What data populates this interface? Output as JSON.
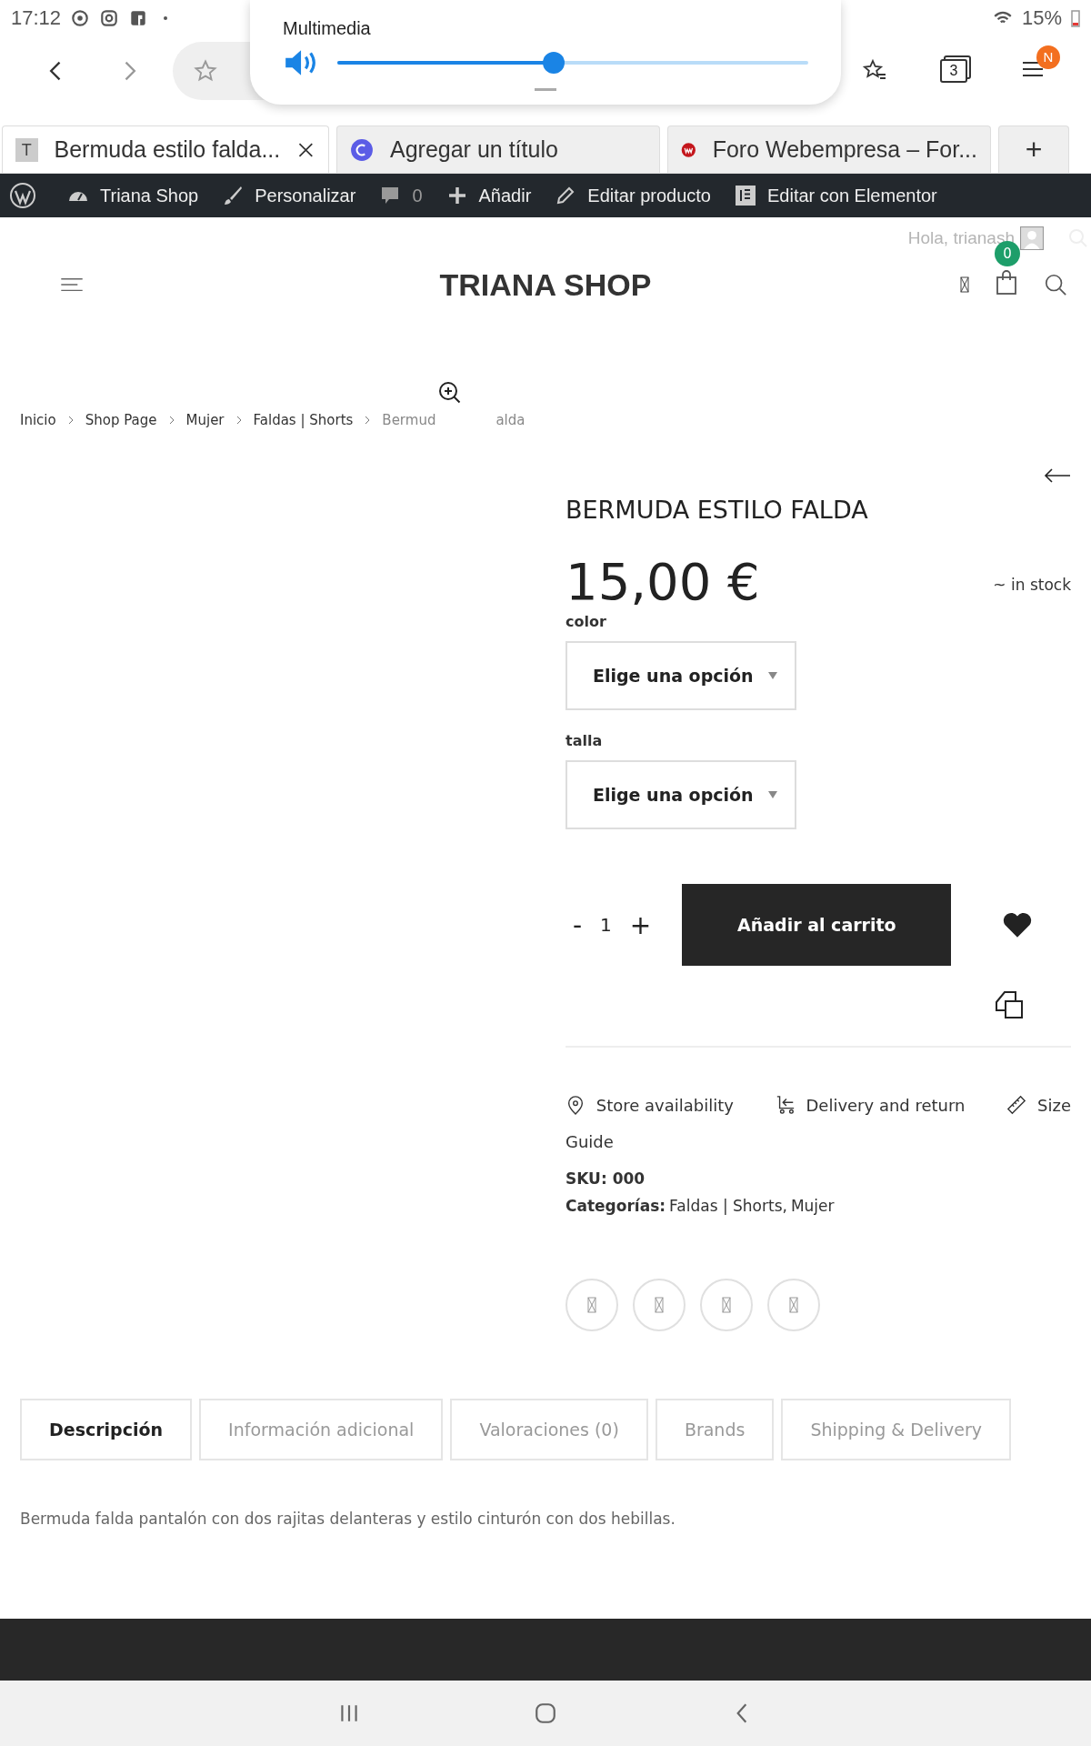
{
  "status_bar": {
    "time": "17:12",
    "battery": "15%"
  },
  "volume_popup": {
    "title": "Multimedia",
    "level": 0.46
  },
  "browser": {
    "tab_count": "3",
    "menu_badge": "N"
  },
  "browser_tabs": [
    {
      "title": "Bermuda estilo falda...",
      "selected": true,
      "icon_text": "T"
    },
    {
      "title": "Agregar un título",
      "selected": false
    },
    {
      "title": "Foro Webempresa – For...",
      "selected": false
    }
  ],
  "new_tab_button": "+",
  "admin_bar": [
    {
      "label": "Triana Shop",
      "muted": false
    },
    {
      "label": "Personalizar",
      "muted": false
    },
    {
      "label": "0",
      "muted": true
    },
    {
      "label": "Añadir",
      "muted": false
    },
    {
      "label": "Editar producto",
      "muted": false
    },
    {
      "label": "Editar con Elementor",
      "muted": false
    }
  ],
  "header": {
    "greeting": "Hola, trianash",
    "logo": "TRIANA SHOP",
    "cart_count": "0"
  },
  "breadcrumb": {
    "items": [
      "Inicio",
      "Shop Page",
      "Mujer",
      "Faldas | Shorts"
    ],
    "current_fragments": [
      "Bermud",
      "alda"
    ]
  },
  "product": {
    "title": "BERMUDA ESTILO FALDA",
    "price": "15,00 €",
    "stock": "~ in stock",
    "attributes": [
      {
        "label": "color",
        "placeholder": "Elige una opción"
      },
      {
        "label": "talla",
        "placeholder": "Elige una opción"
      }
    ],
    "minus": "-",
    "quantity": "1",
    "plus": "+",
    "add_button": "Añadir al carrito",
    "links": [
      "Store availability",
      "Delivery and return",
      "Size"
    ],
    "link_continuation": "Guide",
    "sku": {
      "label": "SKU:",
      "value": "000"
    },
    "categories": {
      "label": "Categorías:",
      "items": [
        "Faldas | Shorts",
        "Mujer"
      ],
      "separator": ","
    }
  },
  "tabs": [
    {
      "label": "Descripción",
      "selected": true
    },
    {
      "label": "Información adicional",
      "selected": false
    },
    {
      "label": "Valoraciones (0)",
      "selected": false
    },
    {
      "label": "Brands",
      "selected": false
    },
    {
      "label": "Shipping & Delivery",
      "selected": false
    }
  ],
  "description": "Bermuda falda pantalón con dos rajitas delanteras y estilo cinturón con dos hebillas."
}
